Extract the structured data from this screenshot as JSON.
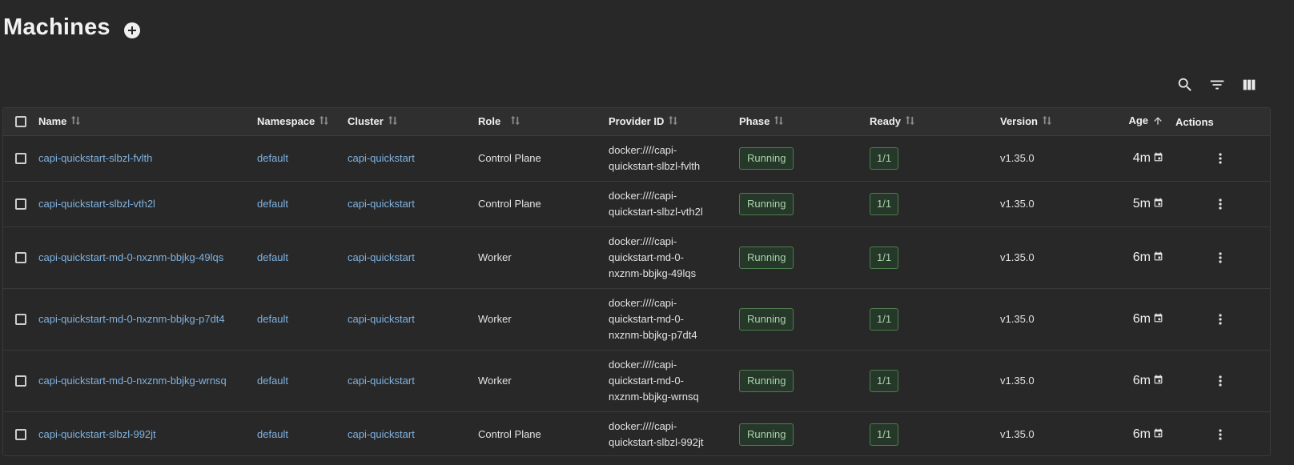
{
  "page": {
    "title": "Machines"
  },
  "toolbar": {
    "search_icon": "search-icon",
    "filter_icon": "filter-icon",
    "columns_icon": "columns-icon"
  },
  "table": {
    "headers": {
      "name": "Name",
      "namespace": "Namespace",
      "cluster": "Cluster",
      "role": "Role",
      "provider_id": "Provider ID",
      "phase": "Phase",
      "ready": "Ready",
      "version": "Version",
      "age": "Age",
      "actions": "Actions"
    },
    "rows": [
      {
        "name": "capi-quickstart-slbzl-fvlth",
        "namespace": "default",
        "cluster": "capi-quickstart",
        "role": "Control Plane",
        "provider_line1": "docker:////capi-",
        "provider_line2": "quickstart-slbzl-fvlth",
        "provider_line3": "",
        "phase": "Running",
        "ready": "1/1",
        "version": "v1.35.0",
        "age": "4m"
      },
      {
        "name": "capi-quickstart-slbzl-vth2l",
        "namespace": "default",
        "cluster": "capi-quickstart",
        "role": "Control Plane",
        "provider_line1": "docker:////capi-",
        "provider_line2": "quickstart-slbzl-vth2l",
        "provider_line3": "",
        "phase": "Running",
        "ready": "1/1",
        "version": "v1.35.0",
        "age": "5m"
      },
      {
        "name": "capi-quickstart-md-0-nxznm-bbjkg-49lqs",
        "namespace": "default",
        "cluster": "capi-quickstart",
        "role": "Worker",
        "provider_line1": "docker:////capi-",
        "provider_line2": "quickstart-md-0-",
        "provider_line3": "nxznm-bbjkg-49lqs",
        "phase": "Running",
        "ready": "1/1",
        "version": "v1.35.0",
        "age": "6m"
      },
      {
        "name": "capi-quickstart-md-0-nxznm-bbjkg-p7dt4",
        "namespace": "default",
        "cluster": "capi-quickstart",
        "role": "Worker",
        "provider_line1": "docker:////capi-",
        "provider_line2": "quickstart-md-0-",
        "provider_line3": "nxznm-bbjkg-p7dt4",
        "phase": "Running",
        "ready": "1/1",
        "version": "v1.35.0",
        "age": "6m"
      },
      {
        "name": "capi-quickstart-md-0-nxznm-bbjkg-wrnsq",
        "namespace": "default",
        "cluster": "capi-quickstart",
        "role": "Worker",
        "provider_line1": "docker:////capi-",
        "provider_line2": "quickstart-md-0-",
        "provider_line3": "nxznm-bbjkg-wrnsq",
        "phase": "Running",
        "ready": "1/1",
        "version": "v1.35.0",
        "age": "6m"
      },
      {
        "name": "capi-quickstart-slbzl-992jt",
        "namespace": "default",
        "cluster": "capi-quickstart",
        "role": "Control Plane",
        "provider_line1": "docker:////capi-",
        "provider_line2": "quickstart-slbzl-992jt",
        "provider_line3": "",
        "phase": "Running",
        "ready": "1/1",
        "version": "v1.35.0",
        "age": "6m"
      }
    ]
  },
  "colors": {
    "background": "#282828",
    "link": "#7fb2e0",
    "running_chip_border": "#4e7d4e",
    "running_chip_text": "#a8d3a8"
  }
}
